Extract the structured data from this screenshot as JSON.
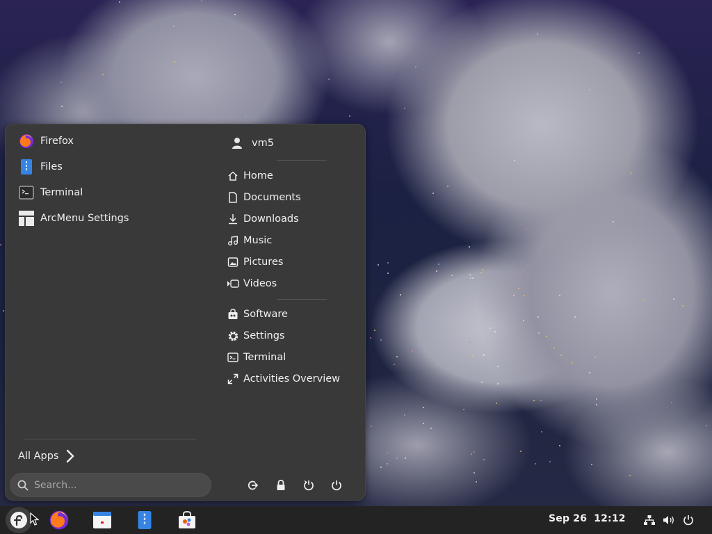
{
  "menu": {
    "pinned_apps": [
      {
        "label": "Firefox",
        "icon": "firefox-icon"
      },
      {
        "label": "Files",
        "icon": "files-icon"
      },
      {
        "label": "Terminal",
        "icon": "terminal-icon"
      },
      {
        "label": "ArcMenu Settings",
        "icon": "arcmenu-settings-icon"
      }
    ],
    "all_apps_label": "All Apps",
    "search_placeholder": "Search...",
    "user": {
      "name": "vm5",
      "icon": "user-icon"
    },
    "places": [
      {
        "label": "Home",
        "icon": "home-icon"
      },
      {
        "label": "Documents",
        "icon": "document-icon"
      },
      {
        "label": "Downloads",
        "icon": "download-icon"
      },
      {
        "label": "Music",
        "icon": "music-icon"
      },
      {
        "label": "Pictures",
        "icon": "pictures-icon"
      },
      {
        "label": "Videos",
        "icon": "videos-icon"
      }
    ],
    "system": [
      {
        "label": "Software",
        "icon": "software-icon"
      },
      {
        "label": "Settings",
        "icon": "gear-icon"
      },
      {
        "label": "Terminal",
        "icon": "terminal-icon"
      },
      {
        "label": "Activities Overview",
        "icon": "activities-icon"
      }
    ],
    "power_buttons": [
      "log-out-icon",
      "lock-icon",
      "restart-icon",
      "power-icon"
    ]
  },
  "taskbar": {
    "apps": [
      "arcmenu-launcher-icon",
      "firefox-icon",
      "calendar-app-icon",
      "files-icon",
      "software-icon"
    ],
    "date": "Sep 26",
    "time": "12:12",
    "tray": [
      "network-icon",
      "volume-icon",
      "power-icon"
    ]
  },
  "colors": {
    "menu_bg": "#393939",
    "taskbar_bg": "#232323",
    "text": "#ececec"
  }
}
